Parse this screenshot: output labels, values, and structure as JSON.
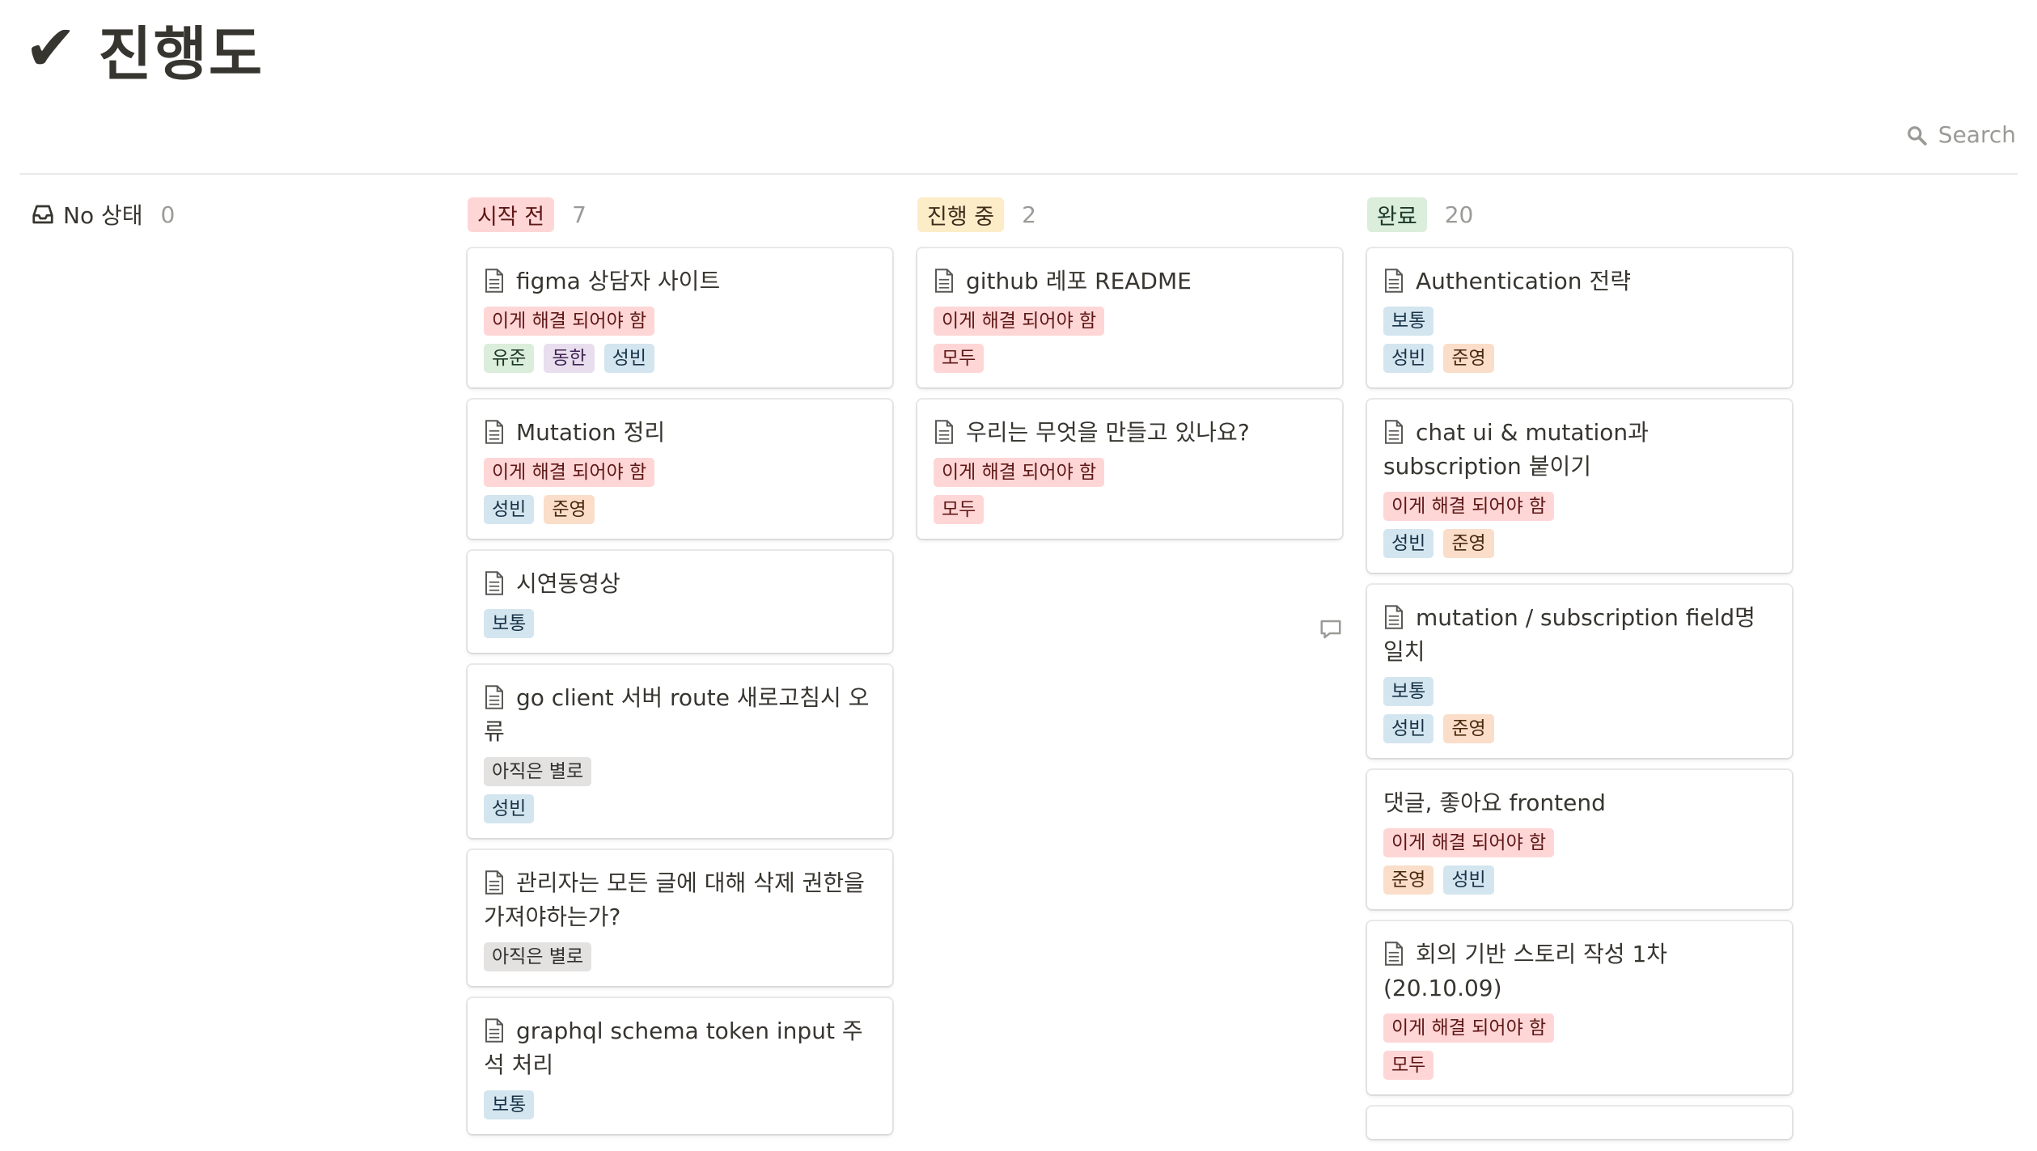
{
  "page": {
    "icon": "✔",
    "title": "진행도"
  },
  "search": {
    "label": "Search",
    "icon": "search-icon"
  },
  "columns": [
    {
      "title": "No 상태",
      "count": "0",
      "cards": []
    },
    {
      "title": "시작 전",
      "count": "7",
      "color": "#ffd6d6",
      "cards": [
        {
          "title": "figma 상담자 사이트",
          "priority": "이게 해결 되어야 함",
          "people": [
            "유준",
            "동한",
            "성빈"
          ]
        },
        {
          "title": "Mutation 정리",
          "priority": "이게 해결 되어야 함",
          "people": [
            "성빈",
            "준영"
          ]
        },
        {
          "title": "시연동영상",
          "priority": "보통",
          "people": []
        },
        {
          "title": "go client 서버 route 새로고침시 오류",
          "priority": "아직은 별로",
          "people": [
            "성빈"
          ]
        },
        {
          "title": "관리자는 모든 글에 대해 삭제 권한을 가져야하는가?",
          "priority": "아직은 별로",
          "people": []
        },
        {
          "title": "graphql schema token input 주석 처리",
          "priority": "보통",
          "people": []
        }
      ]
    },
    {
      "title": "진행 중",
      "count": "2",
      "color": "#fdecc8",
      "cards": [
        {
          "title": "github 레포 README",
          "priority": "이게 해결 되어야 함",
          "people": [
            "모두"
          ]
        },
        {
          "title": "우리는 무엇을 만들고 있나요?",
          "priority": "이게 해결 되어야 함",
          "people": [
            "모두"
          ]
        }
      ]
    },
    {
      "title": "완료",
      "count": "20",
      "color": "#dbeddb",
      "cards": [
        {
          "title": "Authentication 전략",
          "priority": "보통",
          "people": [
            "성빈",
            "준영"
          ]
        },
        {
          "title": "chat ui & mutation과 subscription 붙이기",
          "priority": "이게 해결 되어야 함",
          "people": [
            "성빈",
            "준영"
          ]
        },
        {
          "title": "mutation / subscription field명 일치",
          "priority": "보통",
          "people": [
            "성빈",
            "준영"
          ]
        },
        {
          "title": "댓글, 좋아요 frontend",
          "priority": "이게 해결 되어야 함",
          "people": [
            "준영",
            "성빈"
          ]
        },
        {
          "title": "회의 기반 스토리 작성 1차(20.10.09)",
          "priority": "이게 해결 되어야 함",
          "people": [
            "모두"
          ]
        }
      ]
    }
  ]
}
